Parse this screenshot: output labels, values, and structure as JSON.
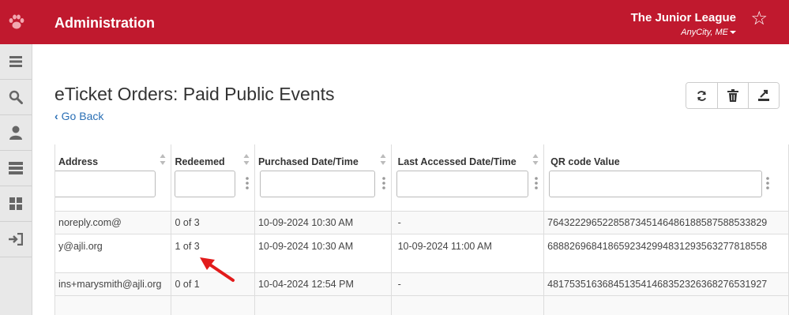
{
  "header": {
    "app_title": "Administration",
    "org_name": "The Junior League",
    "org_location": "AnyCity, ME",
    "brand_color": "#c0192e"
  },
  "sidebar": {
    "items": [
      {
        "icon": "menu-icon"
      },
      {
        "icon": "search-icon"
      },
      {
        "icon": "user-icon"
      },
      {
        "icon": "server-icon"
      },
      {
        "icon": "grid-icon"
      },
      {
        "icon": "sign-in-icon"
      }
    ]
  },
  "page": {
    "title": "eTicket Orders: Paid Public Events",
    "back_label": "Go Back"
  },
  "toolbar": {
    "buttons": [
      {
        "icon": "refresh-icon"
      },
      {
        "icon": "trash-icon"
      },
      {
        "icon": "export-icon"
      }
    ]
  },
  "table": {
    "columns": [
      "Address",
      "Redeemed",
      "Purchased Date/Time",
      "Last Accessed Date/Time",
      "QR code Value"
    ],
    "rows": [
      [
        "@noreply.com",
        "0 of 3",
        "10-09-2024 10:30 AM",
        "-",
        "7643222965228587345146486188587588533829"
      ],
      [
        "y@ajli.org",
        "1 of 3",
        "10-09-2024 10:30 AM",
        "10-09-2024 11:00 AM",
        "6888269684186592342994831293563277818558"
      ],
      [
        "ins+marysmith@ajli.org",
        "0 of 1",
        "10-04-2024 12:54 PM",
        "-",
        "4817535163684513541468352326368276531927"
      ]
    ]
  },
  "annotation": {
    "arrow_color": "#e21b1b"
  }
}
